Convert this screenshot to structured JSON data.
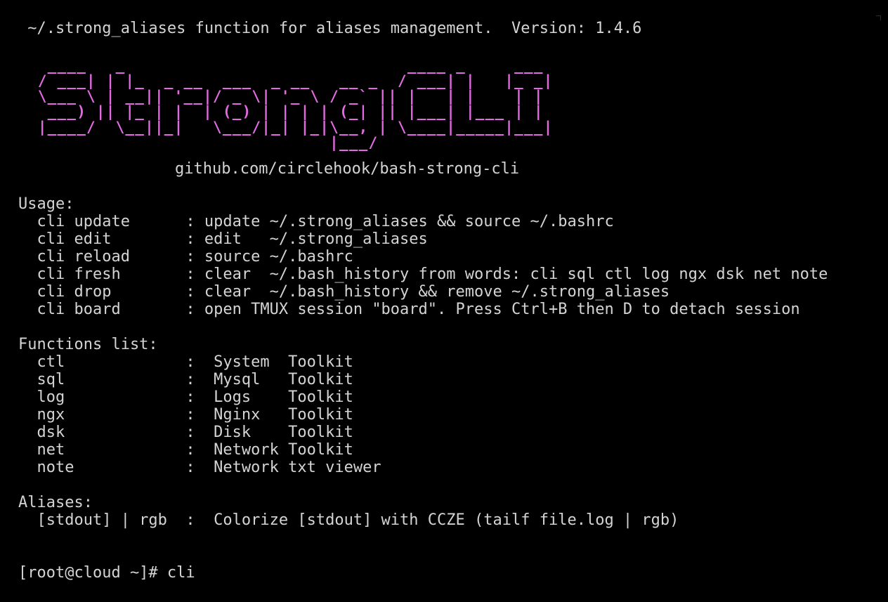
{
  "header_line": " ~/.strong_aliases function for aliases management.  Version: 1.4.6",
  "banner": {
    "art": "  ____   _                             ____ _     ___\n / ___| | |_  _ __  ___  _ __   __ _  / ___| |   |_ _|\n \\___ \\ | __|| '__|/ _ \\| '_ \\ / _` || |   | |    | |\n  ___) || |_ | |  | (_) | | | | (_| || |___| |___ | |\n |____/  \\__||_|   \\___/|_| |_|\\__, | \\____|_____|___|\n                               |___/",
    "color": "#e46ae4"
  },
  "repo_url": "github.com/circlehook/bash-strong-cli",
  "usage": {
    "heading": "Usage:",
    "rows": [
      "  cli update      : update ~/.strong_aliases && source ~/.bashrc",
      "  cli edit        : edit   ~/.strong_aliases",
      "  cli reload      : source ~/.bashrc",
      "  cli fresh       : clear  ~/.bash_history from words: cli sql ctl log ngx dsk net note",
      "  cli drop        : clear  ~/.bash_history && remove ~/.strong_aliases",
      "  cli board       : open TMUX session \"board\". Press Ctrl+B then D to detach session"
    ]
  },
  "functions": {
    "heading": "Functions list:",
    "rows": [
      "  ctl             :  System  Toolkit",
      "  sql             :  Mysql   Toolkit",
      "  log             :  Logs    Toolkit",
      "  ngx             :  Nginx   Toolkit",
      "  dsk             :  Disk    Toolkit",
      "  net             :  Network Toolkit",
      "  note            :  Network txt viewer"
    ]
  },
  "aliases": {
    "heading": "Aliases:",
    "rows": [
      "  [stdout] | rgb  :  Colorize [stdout] with CCZE (tailf file.log | rgb)"
    ]
  },
  "prompt": {
    "text": "[root@cloud ~]# ",
    "command": "cli"
  },
  "colors": {
    "background": "#000000",
    "text": "#d4d4d4",
    "banner": "#e46ae4"
  }
}
